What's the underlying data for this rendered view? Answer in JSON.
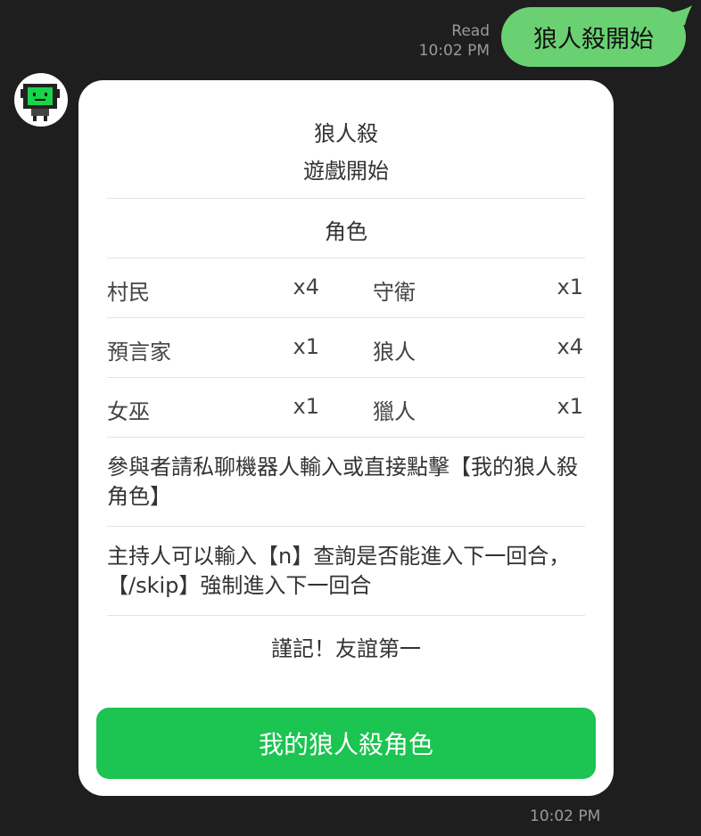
{
  "sent_message": {
    "status": "Read",
    "time": "10:02 PM",
    "text": "狼人殺開始"
  },
  "bot": {
    "avatar_icon": "robot-icon",
    "card": {
      "title_line1": "狼人殺",
      "title_line2": "遊戲開始",
      "roles_header": "角色",
      "roles": [
        {
          "name": "村民",
          "count": "x4"
        },
        {
          "name": "守衛",
          "count": "x1"
        },
        {
          "name": "預言家",
          "count": "x1"
        },
        {
          "name": "狼人",
          "count": "x4"
        },
        {
          "name": "女巫",
          "count": "x1"
        },
        {
          "name": "獵人",
          "count": "x1"
        }
      ],
      "instruction_players": "參與者請私聊機器人輸入或直接點擊【我的狼人殺角色】",
      "instruction_host": "主持人可以輸入【n】查詢是否能進入下一回合，【/skip】強制進入下一回合",
      "footer_note": "謹記！友誼第一",
      "action_label": "我的狼人殺角色"
    },
    "time": "10:02 PM"
  },
  "colors": {
    "background": "#1e1e1e",
    "sent_bubble": "#6ad172",
    "action_button": "#1cc451",
    "card": "#ffffff"
  }
}
